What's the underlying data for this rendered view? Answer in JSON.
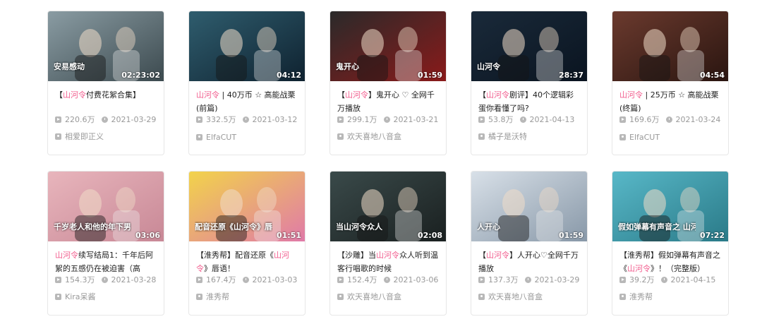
{
  "cards": [
    {
      "title_pre": "【",
      "title_hl": "山河令",
      "title_post": "付费花絮合集】",
      "duration": "02:23:02",
      "views": "220.6万",
      "date": "2021-03-29",
      "uploader": "相爱即正义",
      "overlay": "安易感动",
      "bg1": "#8a9ca3",
      "bg2": "#3c4a4f"
    },
    {
      "title_pre": "",
      "title_hl": "山河令",
      "title_post": " | 40万币 ☆ 高能战栗 (前篇)",
      "duration": "04:12",
      "views": "332.5万",
      "date": "2021-03-12",
      "uploader": "ElfaCUT",
      "overlay": "",
      "bg1": "#2f5d6e",
      "bg2": "#0f2230"
    },
    {
      "title_pre": "【",
      "title_hl": "山河令",
      "title_post": "】鬼开心 ♡ 全网千万播放",
      "duration": "01:59",
      "views": "299.1万",
      "date": "2021-03-21",
      "uploader": "欢天喜地八音盒",
      "overlay": "鬼开心",
      "bg1": "#2a2a2a",
      "bg2": "#8a1a1a"
    },
    {
      "title_pre": "【",
      "title_hl": "山河令",
      "title_post": "剧评】40个逻辑彩蛋你看懂了吗?",
      "duration": "28:37",
      "views": "53.8万",
      "date": "2021-04-13",
      "uploader": "橘子是沃特",
      "overlay": "山河令",
      "bg1": "#1a2a3a",
      "bg2": "#0a1420"
    },
    {
      "title_pre": "",
      "title_hl": "山河令",
      "title_post": " | 25万币 ☆ 高能战栗 (终篇)",
      "duration": "04:54",
      "views": "169.6万",
      "date": "2021-03-24",
      "uploader": "ElfaCUT",
      "overlay": "",
      "bg1": "#6b3a2e",
      "bg2": "#2a1510"
    },
    {
      "title_pre": "",
      "title_hl": "山河令",
      "title_post": "续写结局1：千年后阿絮的五感仍在被迫害（高",
      "duration": "03:06",
      "views": "154.3万",
      "date": "2021-03-28",
      "uploader": "Kira呆酱",
      "overlay": "千岁老人和他的年下男友",
      "bg1": "#e8b5bc",
      "bg2": "#c88896"
    },
    {
      "title_pre": "【淮秀帮】配音还原《",
      "title_hl": "山河令",
      "title_post": "》唇语！",
      "duration": "01:51",
      "views": "167.4万",
      "date": "2021-03-03",
      "uploader": "淮秀帮",
      "overlay": "配音还原《山河令》唇语",
      "bg1": "#f2d34a",
      "bg2": "#e07aa8"
    },
    {
      "title_pre": "【沙雕】当",
      "title_hl": "山河令",
      "title_post": "众人听到温客行唱歌的时候",
      "duration": "02:08",
      "views": "152.4万",
      "date": "2021-03-06",
      "uploader": "欢天喜地八音盒",
      "overlay": "当山河令众人",
      "bg1": "#3a4a4a",
      "bg2": "#1a2020"
    },
    {
      "title_pre": "【",
      "title_hl": "山河令",
      "title_post": "】人开心♡全网千万播放",
      "duration": "01:59",
      "views": "137.3万",
      "date": "2021-03-29",
      "uploader": "欢天喜地八音盒",
      "overlay": "人开心",
      "bg1": "#d8e0e8",
      "bg2": "#8898a8"
    },
    {
      "title_pre": "【淮秀帮】假如弹幕有声音之《",
      "title_hl": "山河令",
      "title_post": "》！（完整版）",
      "duration": "07:22",
      "views": "39.2万",
      "date": "2021-04-15",
      "uploader": "淮秀帮",
      "overlay": "假如弹幕有声音之 山河令",
      "bg1": "#58b8c8",
      "bg2": "#2a7a88"
    }
  ]
}
